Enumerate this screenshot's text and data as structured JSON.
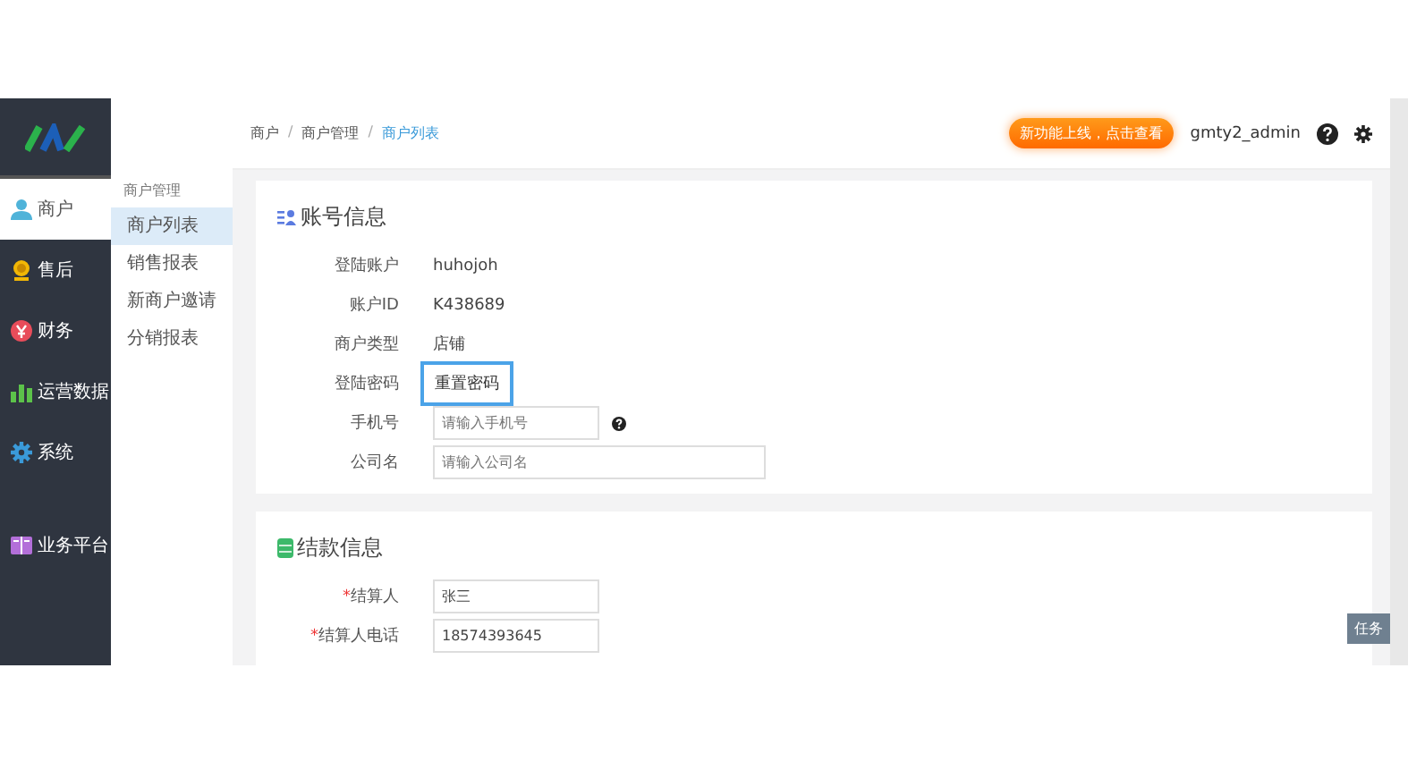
{
  "sidebar": {
    "items": [
      {
        "label": "商户",
        "selected": true
      },
      {
        "label": "售后",
        "selected": false
      },
      {
        "label": "财务",
        "selected": false
      },
      {
        "label": "运营数据",
        "selected": false
      },
      {
        "label": "系统",
        "selected": false
      },
      {
        "label": "业务平台",
        "selected": false
      }
    ]
  },
  "submenu": {
    "heading": "商户管理",
    "items": [
      {
        "label": "商户列表",
        "selected": true
      },
      {
        "label": "销售报表",
        "selected": false
      },
      {
        "label": "新商户邀请",
        "selected": false
      },
      {
        "label": "分销报表",
        "selected": false
      }
    ]
  },
  "breadcrumb": [
    {
      "label": "商户",
      "current": false
    },
    {
      "label": "商户管理",
      "current": false
    },
    {
      "label": "商户列表",
      "current": true
    }
  ],
  "breadcrumb_separator": "/",
  "header": {
    "promo": "新功能上线，点击查看",
    "user": "gmty2_admin"
  },
  "account_section": {
    "title": "账号信息",
    "fields": [
      {
        "kind": "text",
        "label": "登陆账户",
        "value": "huhojoh"
      },
      {
        "kind": "text",
        "label": "账户ID",
        "value": "K438689"
      },
      {
        "kind": "text",
        "label": "商户类型",
        "value": "店铺"
      },
      {
        "kind": "button",
        "label": "登陆密码",
        "value": "重置密码"
      },
      {
        "kind": "input",
        "label": "手机号",
        "placeholder": "请输入手机号",
        "help": true
      },
      {
        "kind": "input_wide",
        "label": "公司名",
        "placeholder": "请输入公司名"
      }
    ]
  },
  "settlement_section": {
    "title": "结款信息",
    "fields": [
      {
        "kind": "input",
        "required_mark": "*",
        "label": "结算人",
        "value": "张三"
      },
      {
        "kind": "input",
        "required_mark": "*",
        "label": "结算人电话",
        "value": "18574393645"
      }
    ]
  },
  "task_button": "任务"
}
